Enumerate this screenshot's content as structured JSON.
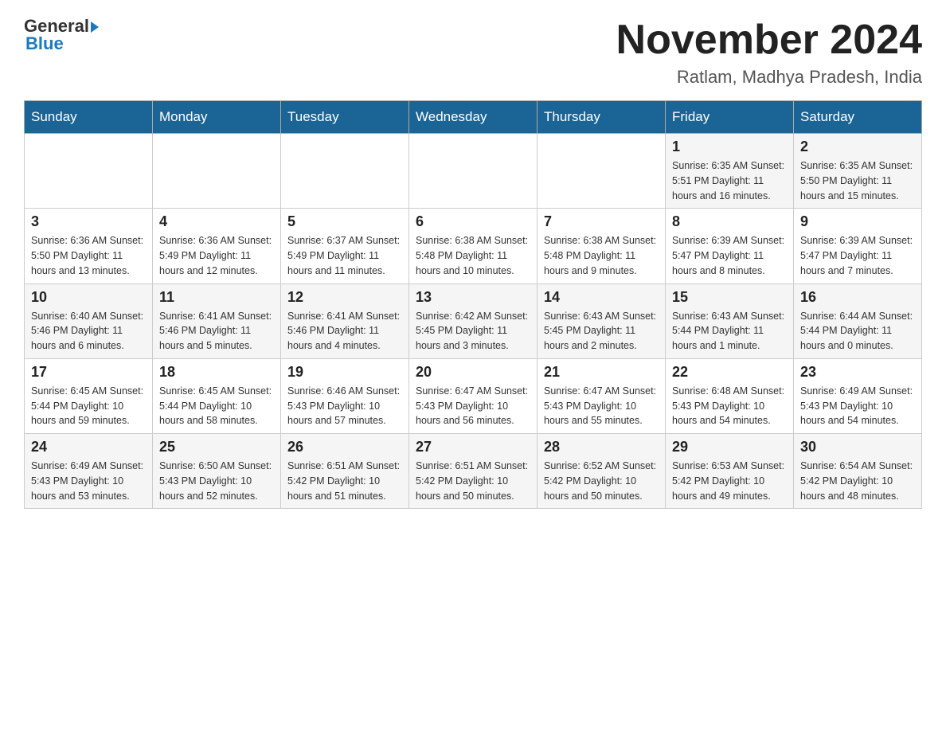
{
  "logo": {
    "general": "General",
    "blue": "Blue",
    "arrow": "▶"
  },
  "header": {
    "month_year": "November 2024",
    "location": "Ratlam, Madhya Pradesh, India"
  },
  "weekdays": [
    "Sunday",
    "Monday",
    "Tuesday",
    "Wednesday",
    "Thursday",
    "Friday",
    "Saturday"
  ],
  "weeks": [
    [
      {
        "day": "",
        "info": ""
      },
      {
        "day": "",
        "info": ""
      },
      {
        "day": "",
        "info": ""
      },
      {
        "day": "",
        "info": ""
      },
      {
        "day": "",
        "info": ""
      },
      {
        "day": "1",
        "info": "Sunrise: 6:35 AM\nSunset: 5:51 PM\nDaylight: 11 hours and 16 minutes."
      },
      {
        "day": "2",
        "info": "Sunrise: 6:35 AM\nSunset: 5:50 PM\nDaylight: 11 hours and 15 minutes."
      }
    ],
    [
      {
        "day": "3",
        "info": "Sunrise: 6:36 AM\nSunset: 5:50 PM\nDaylight: 11 hours and 13 minutes."
      },
      {
        "day": "4",
        "info": "Sunrise: 6:36 AM\nSunset: 5:49 PM\nDaylight: 11 hours and 12 minutes."
      },
      {
        "day": "5",
        "info": "Sunrise: 6:37 AM\nSunset: 5:49 PM\nDaylight: 11 hours and 11 minutes."
      },
      {
        "day": "6",
        "info": "Sunrise: 6:38 AM\nSunset: 5:48 PM\nDaylight: 11 hours and 10 minutes."
      },
      {
        "day": "7",
        "info": "Sunrise: 6:38 AM\nSunset: 5:48 PM\nDaylight: 11 hours and 9 minutes."
      },
      {
        "day": "8",
        "info": "Sunrise: 6:39 AM\nSunset: 5:47 PM\nDaylight: 11 hours and 8 minutes."
      },
      {
        "day": "9",
        "info": "Sunrise: 6:39 AM\nSunset: 5:47 PM\nDaylight: 11 hours and 7 minutes."
      }
    ],
    [
      {
        "day": "10",
        "info": "Sunrise: 6:40 AM\nSunset: 5:46 PM\nDaylight: 11 hours and 6 minutes."
      },
      {
        "day": "11",
        "info": "Sunrise: 6:41 AM\nSunset: 5:46 PM\nDaylight: 11 hours and 5 minutes."
      },
      {
        "day": "12",
        "info": "Sunrise: 6:41 AM\nSunset: 5:46 PM\nDaylight: 11 hours and 4 minutes."
      },
      {
        "day": "13",
        "info": "Sunrise: 6:42 AM\nSunset: 5:45 PM\nDaylight: 11 hours and 3 minutes."
      },
      {
        "day": "14",
        "info": "Sunrise: 6:43 AM\nSunset: 5:45 PM\nDaylight: 11 hours and 2 minutes."
      },
      {
        "day": "15",
        "info": "Sunrise: 6:43 AM\nSunset: 5:44 PM\nDaylight: 11 hours and 1 minute."
      },
      {
        "day": "16",
        "info": "Sunrise: 6:44 AM\nSunset: 5:44 PM\nDaylight: 11 hours and 0 minutes."
      }
    ],
    [
      {
        "day": "17",
        "info": "Sunrise: 6:45 AM\nSunset: 5:44 PM\nDaylight: 10 hours and 59 minutes."
      },
      {
        "day": "18",
        "info": "Sunrise: 6:45 AM\nSunset: 5:44 PM\nDaylight: 10 hours and 58 minutes."
      },
      {
        "day": "19",
        "info": "Sunrise: 6:46 AM\nSunset: 5:43 PM\nDaylight: 10 hours and 57 minutes."
      },
      {
        "day": "20",
        "info": "Sunrise: 6:47 AM\nSunset: 5:43 PM\nDaylight: 10 hours and 56 minutes."
      },
      {
        "day": "21",
        "info": "Sunrise: 6:47 AM\nSunset: 5:43 PM\nDaylight: 10 hours and 55 minutes."
      },
      {
        "day": "22",
        "info": "Sunrise: 6:48 AM\nSunset: 5:43 PM\nDaylight: 10 hours and 54 minutes."
      },
      {
        "day": "23",
        "info": "Sunrise: 6:49 AM\nSunset: 5:43 PM\nDaylight: 10 hours and 54 minutes."
      }
    ],
    [
      {
        "day": "24",
        "info": "Sunrise: 6:49 AM\nSunset: 5:43 PM\nDaylight: 10 hours and 53 minutes."
      },
      {
        "day": "25",
        "info": "Sunrise: 6:50 AM\nSunset: 5:43 PM\nDaylight: 10 hours and 52 minutes."
      },
      {
        "day": "26",
        "info": "Sunrise: 6:51 AM\nSunset: 5:42 PM\nDaylight: 10 hours and 51 minutes."
      },
      {
        "day": "27",
        "info": "Sunrise: 6:51 AM\nSunset: 5:42 PM\nDaylight: 10 hours and 50 minutes."
      },
      {
        "day": "28",
        "info": "Sunrise: 6:52 AM\nSunset: 5:42 PM\nDaylight: 10 hours and 50 minutes."
      },
      {
        "day": "29",
        "info": "Sunrise: 6:53 AM\nSunset: 5:42 PM\nDaylight: 10 hours and 49 minutes."
      },
      {
        "day": "30",
        "info": "Sunrise: 6:54 AM\nSunset: 5:42 PM\nDaylight: 10 hours and 48 minutes."
      }
    ]
  ]
}
